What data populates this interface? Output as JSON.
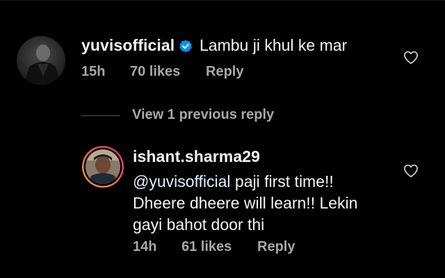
{
  "comment": {
    "username": "yuvisofficial",
    "verified": true,
    "text": "Lambu ji khul ke mar",
    "time": "15h",
    "likes": "70 likes",
    "reply_label": "Reply",
    "avatar_icon": "user-avatar-photo",
    "like_icon": "heart-outline-icon"
  },
  "view_replies_label": "View 1 previous reply",
  "reply": {
    "username": "ishant.sharma29",
    "mention": "@yuvisofficial",
    "text_after_mention": " paji first time!!",
    "line2": "Dheere dheere will learn!! Lekin",
    "line3": "gayi bahot door thi",
    "time": "14h",
    "likes": "61 likes",
    "reply_label": "Reply",
    "avatar_icon": "user-avatar-photo-story-ring",
    "like_icon": "heart-outline-icon"
  },
  "colors": {
    "background": "#000000",
    "primary_text": "#f5f5f5",
    "secondary_text": "#a8a8a8",
    "verified_badge": "#0095f6",
    "mention": "#e0f1ff",
    "story_ring_start": "#f9a13b",
    "story_ring_end": "#d62976"
  }
}
